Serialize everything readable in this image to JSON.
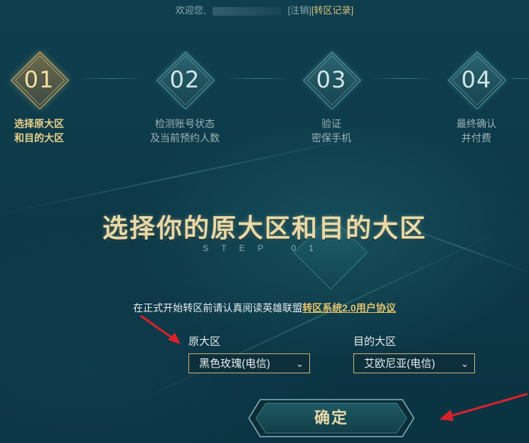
{
  "header": {
    "welcome": "欢迎您,",
    "logout": "[注销]",
    "record": "[转区记录]"
  },
  "steps": [
    {
      "num": "01",
      "line1": "选择原大区",
      "line2": "和目的大区",
      "active": true
    },
    {
      "num": "02",
      "line1": "检测账号状态",
      "line2": "及当前预约人数",
      "active": false
    },
    {
      "num": "03",
      "line1": "验证",
      "line2": "密保手机",
      "active": false
    },
    {
      "num": "04",
      "line1": "最终确认",
      "line2": "并付费",
      "active": false
    }
  ],
  "main": {
    "title": "选择你的原大区和目的大区",
    "step_tag": "STEP 01",
    "agreement_text": "在正式开始转区前请认真阅读英雄联盟",
    "agreement_link": "转区系统2.0用户协议"
  },
  "form": {
    "source_label": "原大区",
    "source_value": "黑色玫瑰(电信)",
    "target_label": "目的大区",
    "target_value": "艾欧尼亚(电信)",
    "confirm_label": "确定"
  },
  "colors": {
    "gold": "#e6c26a",
    "teal_bg": "#0d3948",
    "arrow_red": "#d8222a"
  }
}
